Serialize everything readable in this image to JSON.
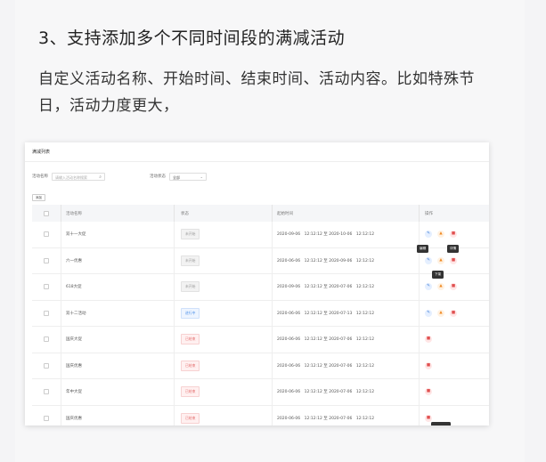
{
  "heading": "3、支持添加多个不同时间段的满减活动",
  "description": "自定义活动名称、开始时间、结束时间、活动内容。比如特殊节日，活动力度更大，",
  "screenshot": {
    "title": "满减列表",
    "filters": {
      "name_label": "活动名称",
      "name_placeholder": "请输入活动名称搜索",
      "status_label": "活动状态",
      "status_value": "全部"
    },
    "add_button": "添加",
    "columns": [
      "活动名称",
      "状态",
      "起始时间",
      "操作"
    ],
    "rows": [
      {
        "name": "双十一大促",
        "status": "未开始",
        "status_type": "grey",
        "time": "2020-09-06　12:12:12 至 2020-10-06　12:12:12",
        "actions": [
          "edit",
          "warn",
          "del"
        ]
      },
      {
        "name": "六一优惠",
        "status": "未开始",
        "status_type": "grey",
        "time": "2020-06-06　12:12:12 至 2020-09-06　12:12:12",
        "actions": [
          "edit",
          "warn",
          "del"
        ]
      },
      {
        "name": "618大促",
        "status": "未开始",
        "status_type": "grey",
        "time": "2020-09-06　12:12:12 至 2020-07-06　12:12:12",
        "actions": [
          "edit",
          "warn",
          "del"
        ]
      },
      {
        "name": "双十二活动",
        "status": "进行中",
        "status_type": "blue",
        "time": "2020-06-06　12:12:12 至 2020-07-13　12:12:12",
        "actions": [
          "edit",
          "warn",
          "del"
        ]
      },
      {
        "name": "国庆大促",
        "status": "已结束",
        "status_type": "red",
        "time": "2020-06-06　12:12:12 至 2020-07-06　12:12:12",
        "actions": [
          "del"
        ]
      },
      {
        "name": "国庆优惠",
        "status": "已结束",
        "status_type": "red",
        "time": "2020-06-06　12:12:12 至 2020-07-06　12:12:12",
        "actions": [
          "del"
        ]
      },
      {
        "name": "年中大促",
        "status": "已结束",
        "status_type": "red",
        "time": "2020-06-06　12:12:12 至 2020-07-06　12:12:12",
        "actions": [
          "del"
        ]
      },
      {
        "name": "国庆优惠",
        "status": "已结束",
        "status_type": "red",
        "time": "2020-06-06　12:12:12 至 2020-07-06　12:12:12",
        "actions": [
          "del"
        ]
      }
    ],
    "tooltips": {
      "edit": "编辑",
      "detail": "详情",
      "offline": "下架"
    },
    "icon_glyphs": {
      "edit": "✎",
      "warn": "▲",
      "del": "■"
    }
  }
}
